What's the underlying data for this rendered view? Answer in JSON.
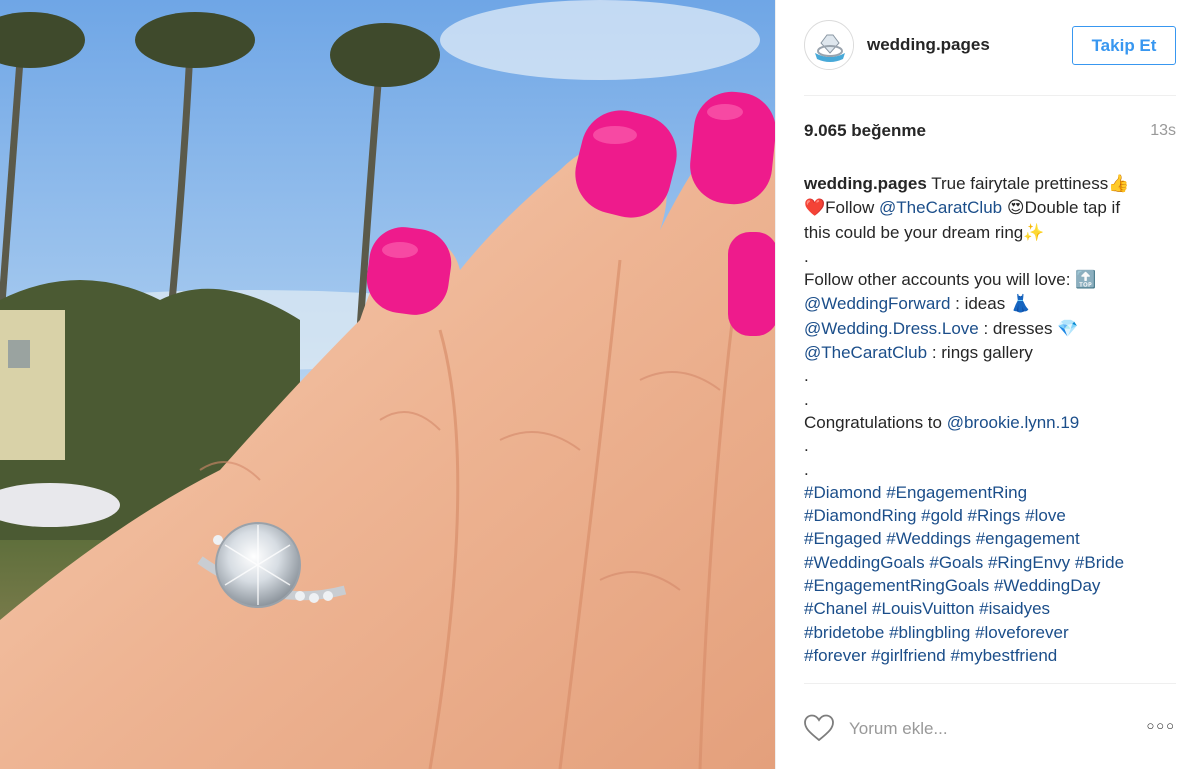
{
  "post": {
    "username": "wedding.pages",
    "follow_label": "Takip Et",
    "likes": "9.065 beğenme",
    "time": "13s"
  },
  "caption": {
    "author": "wedding.pages",
    "l1_text": " True fairytale prettiness",
    "l1_emoji": "👍",
    "l2_emoji1": "❤️",
    "l2_text1": "Follow ",
    "l2_link": "@TheCaratClub",
    "l2_emoji2": "😍",
    "l2_text2": "Double tap if",
    "l3_text": "this could be your dream ring",
    "l3_emoji": "✨",
    "dot": ".",
    "follow_other": "Follow other accounts you will love: ",
    "top_emoji": "🔝",
    "acc1": "@WeddingForward",
    "acc1_text": " : ideas ",
    "acc1_emoji": "👗",
    "acc2": "@Wedding.Dress.Love",
    "acc2_text": " : dresses ",
    "acc2_emoji": "💎",
    "acc3": "@TheCaratClub",
    "acc3_text": " : rings gallery",
    "congrats": "Congratulations to ",
    "congrats_user": "@brookie.lynn.19",
    "tags": [
      "#Diamond #EngagementRing",
      "#DiamondRing #gold #Rings #love",
      "#Engaged #Weddings #engagement",
      "#WeddingGoals #Goals #RingEnvy #Bride",
      "#EngagementRingGoals #WeddingDay",
      "#Chanel #LouisVuitton #isaidyes",
      "#bridetobe #blingbling #loveforever",
      "#forever #girlfriend #mybestfriend"
    ]
  },
  "comment": {
    "placeholder": "Yorum ekle...",
    "more_label": "○○○"
  },
  "icons": {
    "heart": "heart-outline-icon",
    "more": "more-options-icon"
  },
  "colors": {
    "link": "#1b4e8a",
    "follow": "#3897f0",
    "muted": "#999999",
    "nail": "#ee1b8c"
  }
}
